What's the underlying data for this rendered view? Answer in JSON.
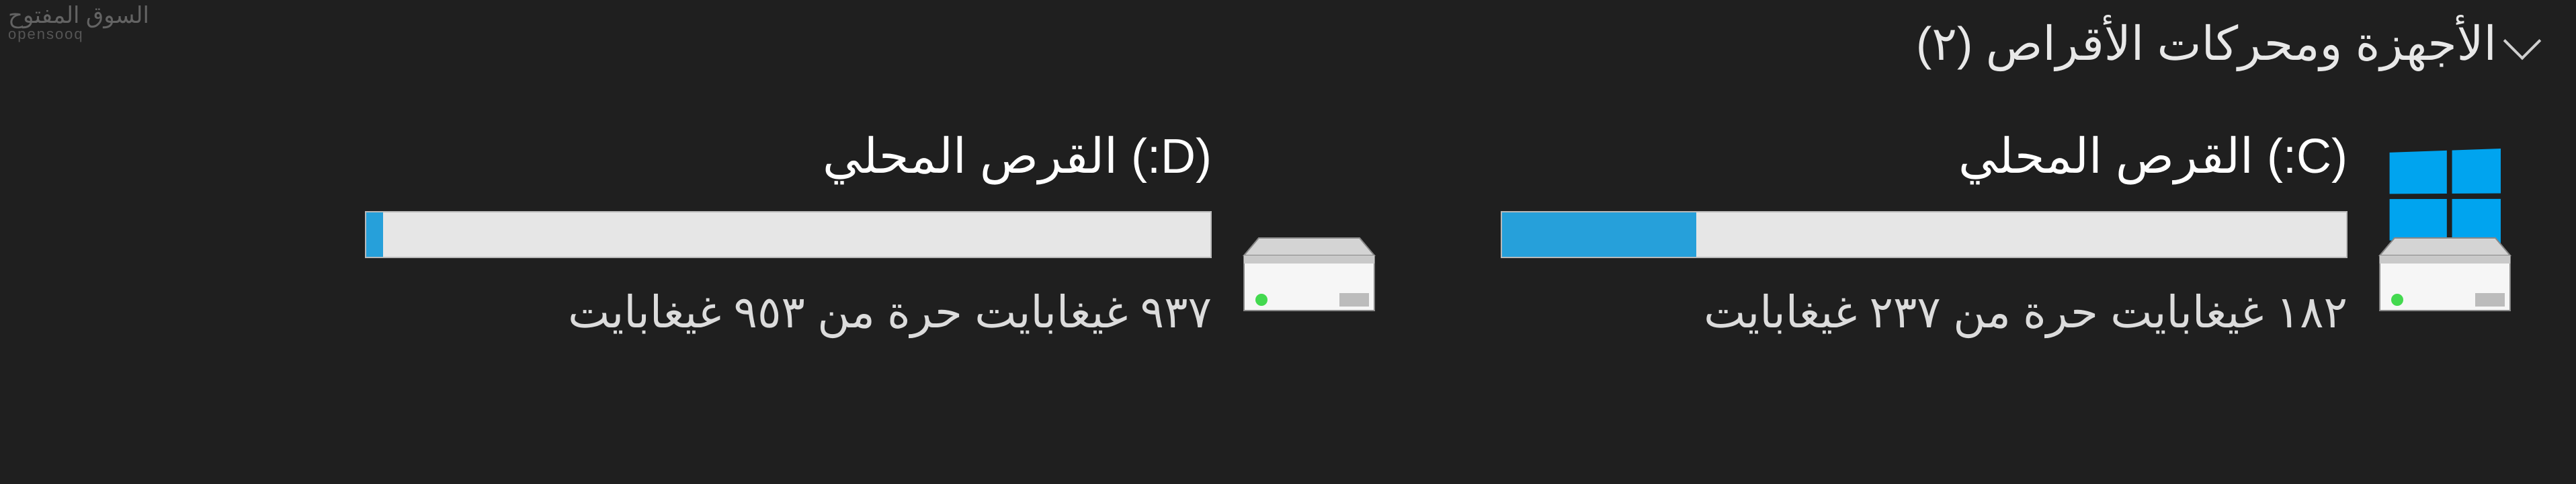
{
  "watermark": {
    "main": "السوق المفتوح",
    "sub": "opensooq"
  },
  "section_title": "الأجهزة ومحركات الأقراص (٢)",
  "drives": [
    {
      "name": "(C:) القرص المحلي",
      "free_label": "١٨٢ غيغابايت حرة من ٢٣٧ غيغابايت",
      "used_percent": 23,
      "os_drive": true
    },
    {
      "name": "(D:) القرص المحلي",
      "free_label": "٩٣٧ غيغابايت حرة من ٩٥٣ غيغابايت",
      "used_percent": 2,
      "os_drive": false
    }
  ],
  "accent": "#26A0DA"
}
